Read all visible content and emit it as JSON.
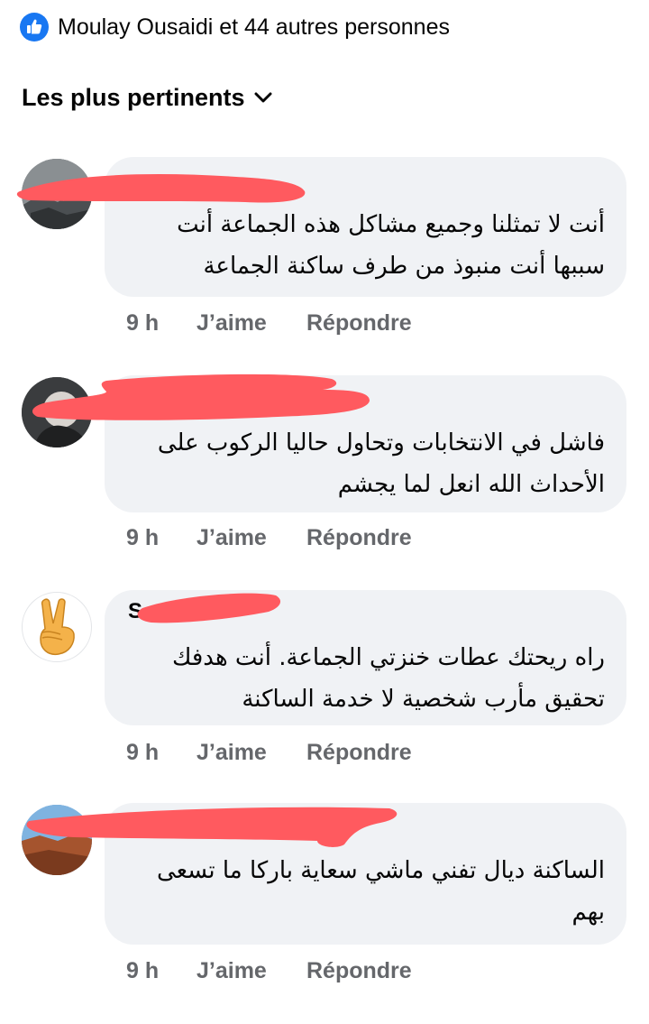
{
  "reactions": {
    "icon": "thumbs-up-icon",
    "text": "Moulay Ousaidi et 44 autres personnes",
    "color": "#1877f2"
  },
  "sort": {
    "label": "Les plus pertinents",
    "icon": "chevron-down-icon"
  },
  "redaction_color": "#ff5a5f",
  "comments": [
    {
      "author": "",
      "text": "أنت لا تمثلنا وجميع مشاكل هذه الجماعة أنت سببها أنت منبوذ من طرف ساكنة الجماعة",
      "time": "9 h",
      "like": "J’aime",
      "reply": "Répondre"
    },
    {
      "author": "",
      "text": "فاشل في الانتخابات وتحاول حاليا الركوب على الأحداث الله انعل لما يجشم",
      "time": "9 h",
      "like": "J’aime",
      "reply": "Répondre"
    },
    {
      "author": "S",
      "text": "راه ريحتك عطات خنزتي الجماعة. أنت هدفك تحقيق مأرب شخصية لا خدمة الساكنة",
      "avatar_icon": "victory-hand-icon",
      "time": "9 h",
      "like": "J’aime",
      "reply": "Répondre"
    },
    {
      "author": "",
      "text": "الساكنة ديال تفني ماشي سعاية باركا ما تسعى بهم",
      "time": "9 h",
      "like": "J’aime",
      "reply": "Répondre"
    }
  ]
}
